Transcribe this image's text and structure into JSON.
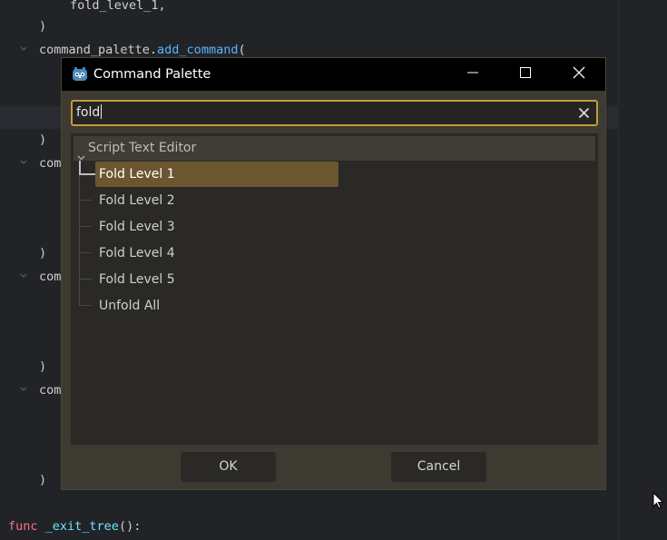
{
  "editor": {
    "lines": [
      {
        "indent": "      ",
        "parts": [
          {
            "t": "fold_level_1,",
            "c": ""
          }
        ]
      },
      {
        "indent": "   ",
        "parts": [
          {
            "t": ")",
            "c": ""
          }
        ]
      },
      {
        "indent": "   ",
        "parts": [
          {
            "t": "command_palette.",
            "c": ""
          },
          {
            "t": "add_command",
            "c": "fn"
          },
          {
            "t": "(",
            "c": ""
          }
        ]
      },
      {
        "indent": "   ",
        "parts": [
          {
            "t": ")",
            "c": ""
          }
        ]
      },
      {
        "indent": "   ",
        "parts": [
          {
            "t": "com",
            "c": ""
          }
        ]
      },
      {
        "indent": "   ",
        "parts": [
          {
            "t": ")",
            "c": ""
          }
        ]
      },
      {
        "indent": "   ",
        "parts": [
          {
            "t": "com",
            "c": ""
          }
        ]
      },
      {
        "indent": "   ",
        "parts": [
          {
            "t": ")",
            "c": ""
          }
        ]
      },
      {
        "indent": "   ",
        "parts": [
          {
            "t": "com",
            "c": ""
          }
        ]
      },
      {
        "indent": "   ",
        "parts": [
          {
            "t": ")",
            "c": ""
          }
        ]
      },
      {
        "indent": "",
        "parts": [
          {
            "t": "func",
            "c": "kw"
          },
          {
            "t": " ",
            "c": ""
          },
          {
            "t": "_exit_tree",
            "c": "fname"
          },
          {
            "t": "():",
            "c": ""
          }
        ]
      }
    ]
  },
  "dialog": {
    "title": "Command Palette",
    "search": {
      "value": "fold",
      "placeholder": ""
    },
    "group": {
      "label": "Script Text Editor"
    },
    "items": [
      {
        "label": "Fold Level 1",
        "selected": true
      },
      {
        "label": "Fold Level 2",
        "selected": false
      },
      {
        "label": "Fold Level 3",
        "selected": false
      },
      {
        "label": "Fold Level 4",
        "selected": false
      },
      {
        "label": "Fold Level 5",
        "selected": false
      },
      {
        "label": "Unfold All",
        "selected": false
      }
    ],
    "buttons": {
      "ok": "OK",
      "cancel": "Cancel"
    }
  },
  "colors": {
    "accent": "#c49b3c",
    "selection": "#6b5630",
    "keyword": "#ff7085",
    "function": "#57b3ff"
  },
  "icons": {
    "app": "godot-icon",
    "minimize": "minimize-icon",
    "maximize": "maximize-icon",
    "close": "close-icon",
    "clear": "clear-icon",
    "chevron": "chevron-down-icon",
    "cursor": "mouse-pointer-icon"
  }
}
